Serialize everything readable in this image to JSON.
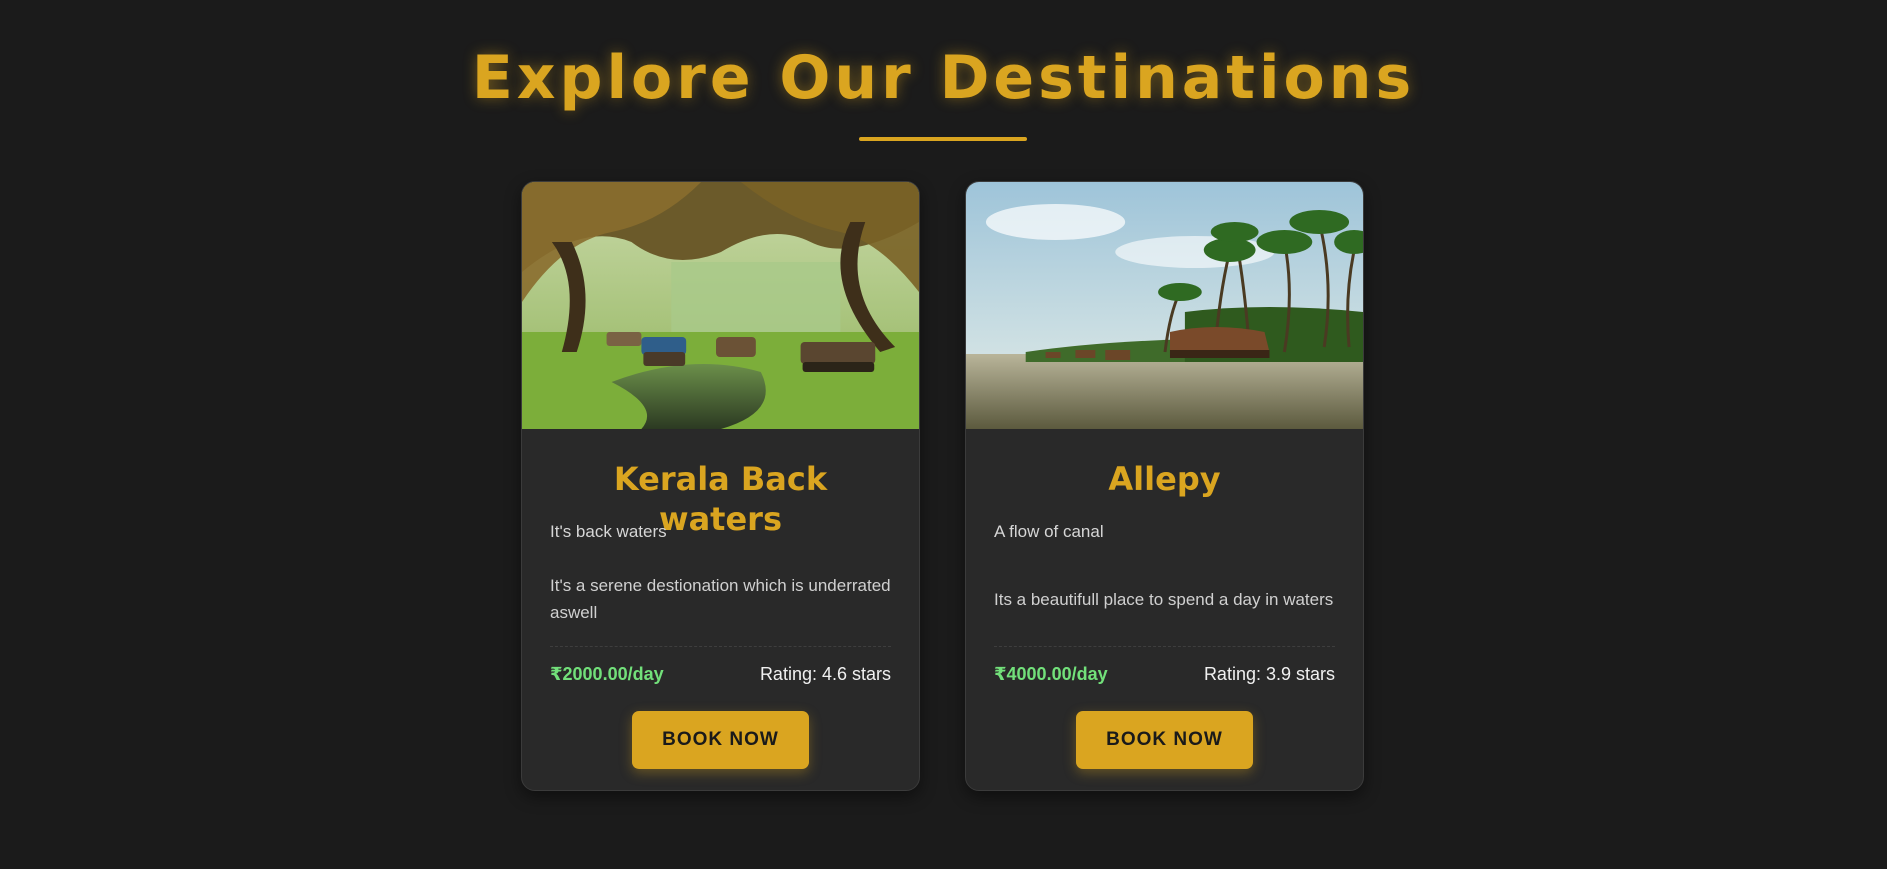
{
  "page": {
    "title": "Explore Our Destinations",
    "accent_color": "#DAA520",
    "price_color": "#72e07a",
    "background_color": "#1b1b1b"
  },
  "destinations": [
    {
      "image_icon": "backwaters-photo",
      "title": "Kerala Back waters",
      "subtitle": "It's back waters",
      "description": "It's a serene destionation which is underrated aswell",
      "price": "₹2000.00/day",
      "rating": "Rating: 4.6 stars",
      "button_label": "BOOK NOW"
    },
    {
      "image_icon": "houseboat-canal-photo",
      "title": "Allepy",
      "subtitle": "A flow of canal",
      "description": "Its a beautifull place to spend a day in waters",
      "price": "₹4000.00/day",
      "rating": "Rating: 3.9 stars",
      "button_label": "BOOK NOW"
    }
  ]
}
